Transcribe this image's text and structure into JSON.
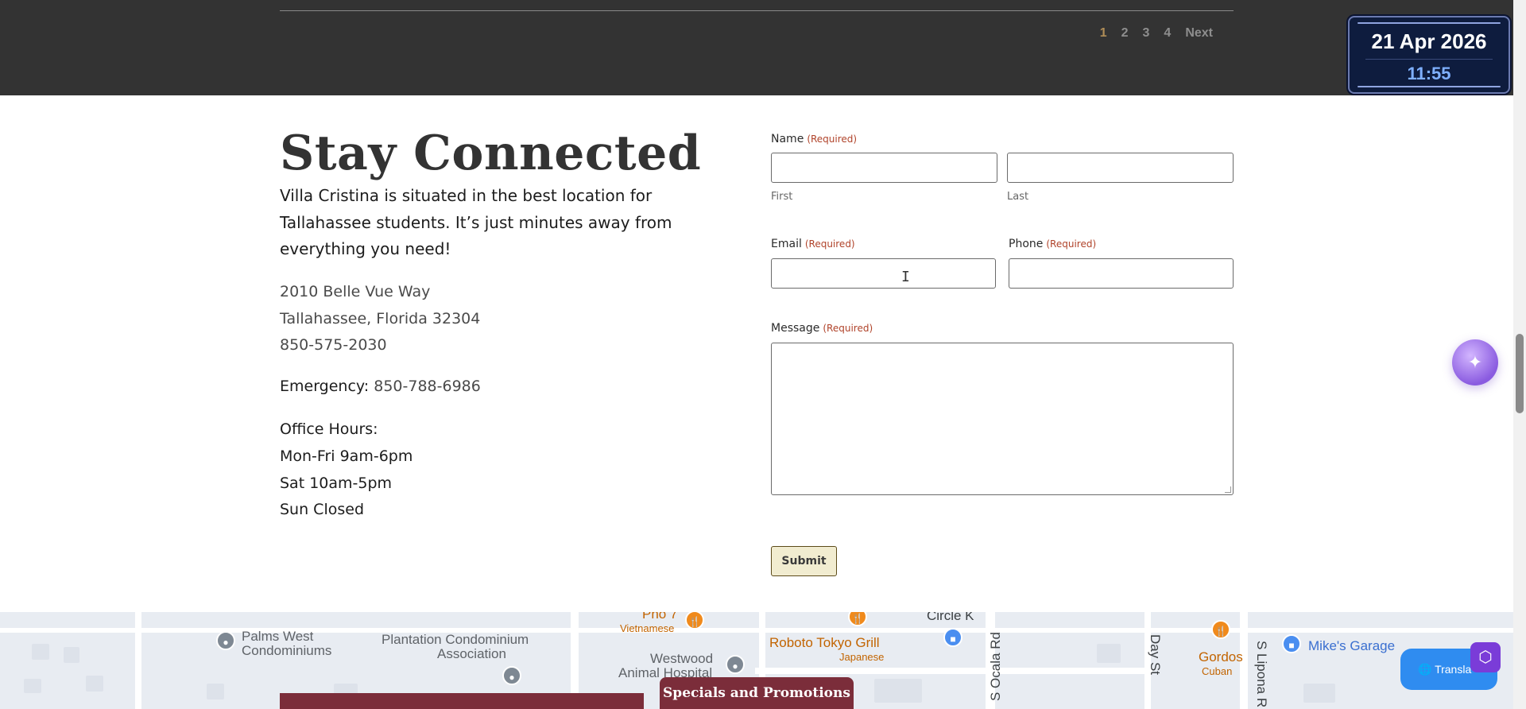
{
  "pagination": {
    "pages": [
      "1",
      "2",
      "3",
      "4"
    ],
    "next": "Next",
    "active": "1"
  },
  "datetime": {
    "date": "21 Apr 2026",
    "time": "11:55"
  },
  "contact": {
    "heading": "Stay Connected",
    "intro": "Villa Cristina is situated in the best location for Tallahassee students. It’s just minutes away from everything you need!",
    "address_line1": "2010 Belle Vue Way",
    "address_line2": "Tallahassee, Florida 32304",
    "phone": "850-575-2030",
    "emergency_label": "Emergency:",
    "emergency_phone": "850-788-6986",
    "hours_title": "Office Hours:",
    "hours": [
      "Mon-Fri 9am-6pm",
      "Sat 10am-5pm",
      "Sun Closed"
    ]
  },
  "form": {
    "name_label": "Name",
    "required": "(Required)",
    "first_sub": "First",
    "last_sub": "Last",
    "email_label": "Email",
    "phone_label": "Phone",
    "message_label": "Message",
    "first_value": "",
    "last_value": "",
    "email_value": "",
    "phone_value": "",
    "message_value": "",
    "submit": "Submit"
  },
  "map": {
    "labels": {
      "palms_west_1": "Palms West",
      "palms_west_2": "Condominiums",
      "plantation_1": "Plantation Condominium",
      "plantation_2": "Association",
      "pho": "Pho 7",
      "vietnamese": "Vietnamese",
      "westwood_1": "Westwood",
      "westwood_2": "Animal Hospital",
      "roboto": "Roboto Tokyo Grill",
      "japanese": "Japanese",
      "circle_k": "Circle K",
      "ocala": "S Ocala Rd",
      "day_st": "Day St",
      "lipona": "S Lipona R",
      "gordos": "Gordos",
      "cuban": "Cuban",
      "mikes": "Mike's Garage"
    }
  },
  "specials_tab": "Specials and Promotions",
  "translate_label": "🌐 Transla",
  "colors": {
    "accent_gold": "#b08d57",
    "maroon": "#7b2d3a",
    "dark_band": "#333333",
    "required_red": "#b0432a"
  }
}
